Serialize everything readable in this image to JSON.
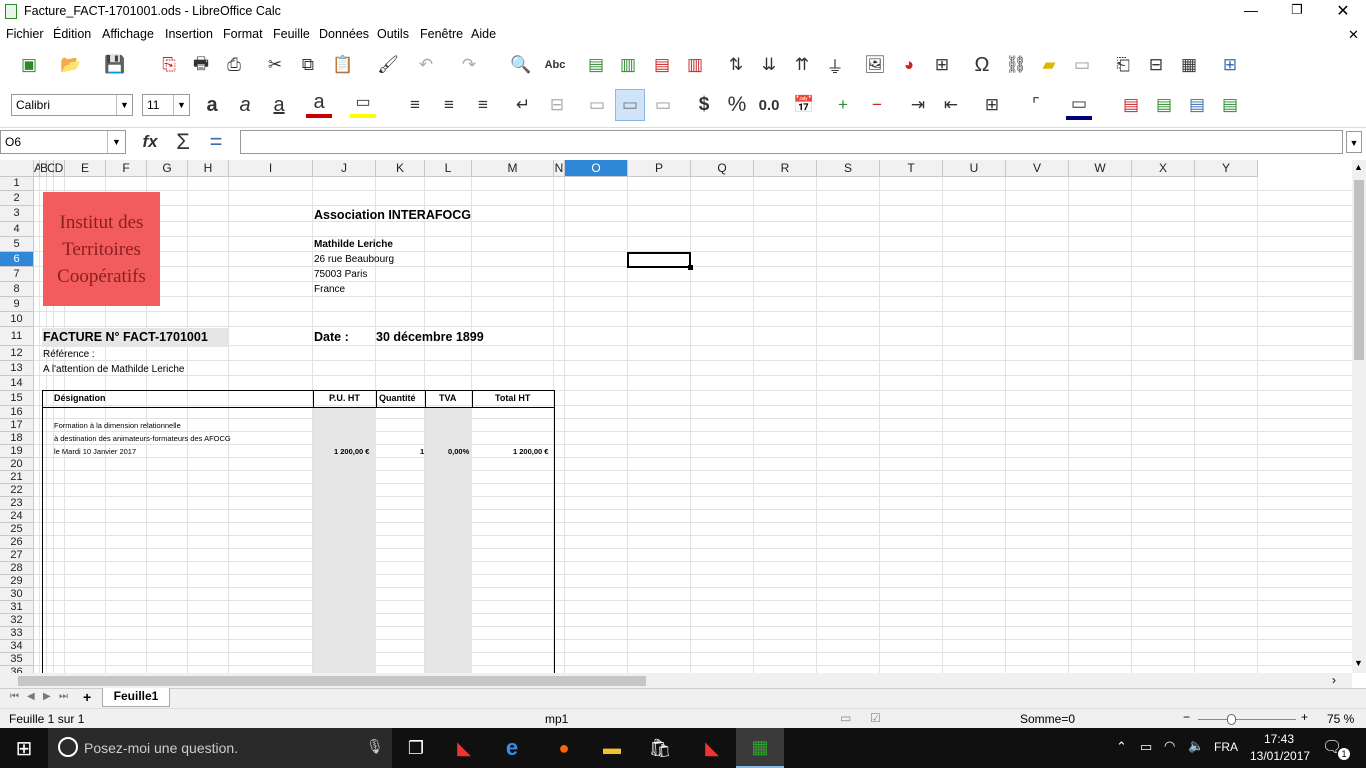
{
  "window": {
    "title": "Facture_FACT-1701001.ods - LibreOffice Calc"
  },
  "menu": [
    "Fichier",
    "Édition",
    "Affichage",
    "Insertion",
    "Format",
    "Feuille",
    "Données",
    "Outils",
    "Fenêtre",
    "Aide"
  ],
  "format_bar": {
    "font_name": "Calibri",
    "font_size": "11",
    "currency": "$",
    "percent": "%",
    "decimal": "0.0"
  },
  "formula_bar": {
    "cell_ref": "O6",
    "formula": ""
  },
  "columns": [
    "A",
    "B",
    "C",
    "D",
    "E",
    "F",
    "G",
    "H",
    "I",
    "J",
    "K",
    "L",
    "M",
    "N",
    "O",
    "P",
    "Q",
    "R",
    "S",
    "T",
    "U",
    "V",
    "W",
    "X",
    "Y"
  ],
  "rows": [
    "1",
    "2",
    "3",
    "4",
    "5",
    "6",
    "7",
    "8",
    "9",
    "10",
    "11",
    "12",
    "13",
    "14",
    "15",
    "16",
    "17",
    "18",
    "19",
    "20",
    "21",
    "22",
    "23",
    "24",
    "25",
    "26",
    "27",
    "28",
    "29",
    "30",
    "31",
    "32",
    "33",
    "34",
    "35",
    "36"
  ],
  "logo": {
    "line1": "Institut des",
    "line2": "Territoires",
    "line3": "Coopératifs",
    "color": "#f25c5c"
  },
  "sheet": {
    "assoc": "Association INTERAFOCG",
    "contact_name": "Mathilde Leriche",
    "address1": "26 rue Beaubourg",
    "address2": "75003 Paris",
    "country": "France",
    "invoice_label": "FACTURE N°  FACT-1701001",
    "date_label": "Date :",
    "date_value": "30 décembre 1899",
    "reference": "Référence :",
    "attention": "A l'attention de  Mathilde  Leriche",
    "table_headers": {
      "designation": "Désignation",
      "pu": "P.U. HT",
      "qty": "Quantité",
      "tva": "TVA",
      "total": "Total HT"
    },
    "line1": "Formation à la dimension relationnelle",
    "line2": "à destination des animateurs-formateurs des AFOCG",
    "line3": "le Mardi 10 Janvier 2017",
    "pu_value": "1 200,00 €",
    "qty_value": "1",
    "tva_value": "0,00%",
    "total_value": "1 200,00 €"
  },
  "sheet_tabs": {
    "active": "Feuille1"
  },
  "status": {
    "sheet_info": "Feuille 1 sur 1",
    "style": "mp1",
    "sum": "Somme=0",
    "zoom": "75 %"
  },
  "taskbar": {
    "search_placeholder": "Posez-moi une question.",
    "lang": "FRA",
    "time": "17:43",
    "date": "13/01/2017",
    "notif": "1"
  }
}
